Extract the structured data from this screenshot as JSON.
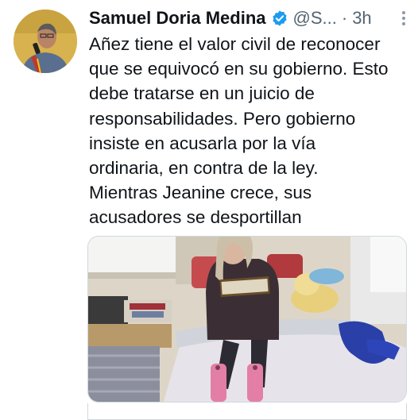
{
  "tweet": {
    "author_name": "Samuel Doria Medina",
    "handle": "@S...",
    "separator": "·",
    "time": "3h",
    "verified": true,
    "text": "Añez tiene el valor civil de reconocer\nque se equivocó en su gobierno. Esto\ndebe tratarse en un juicio de\nresponsabilidades. Pero gobierno\ninsiste en acusarla por la vía\nordinaria, en contra de la ley.\nMientras Jeanine crece, sus\nacusadores se desportillan"
  },
  "icons": {
    "verified": "verified-badge-icon",
    "more": "more-options-icon"
  },
  "colors": {
    "verified_badge": "#1d9bf0",
    "secondary_text": "#536471",
    "primary_text": "#0f1419",
    "border": "#cfd9de"
  }
}
